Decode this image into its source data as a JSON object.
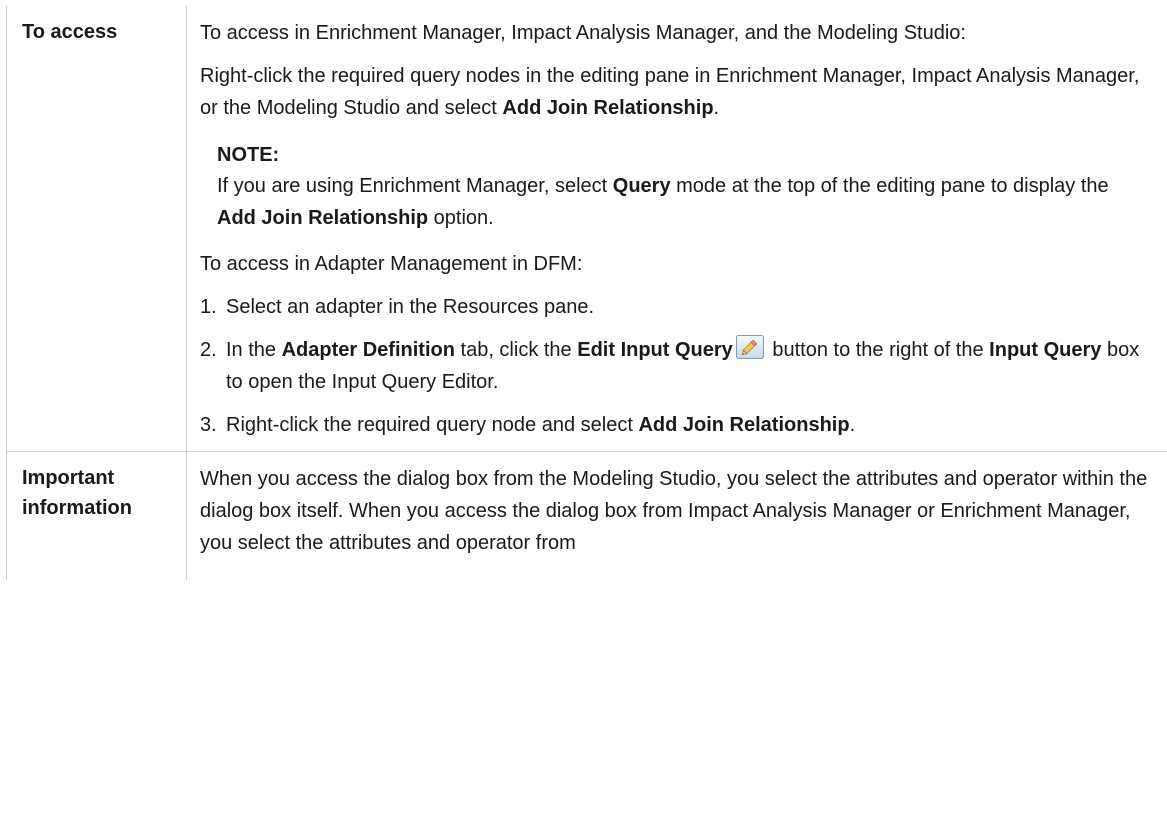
{
  "rows": [
    {
      "label": "To access",
      "intro": "To access in Enrichment Manager, Impact Analysis Manager, and the Modeling Studio:",
      "rightclick": {
        "pre": "Right-click the required query nodes in the editing pane in Enrichment Manager, Impact Analysis Manager, or the Modeling Studio and select ",
        "bold": "Add Join Relationship",
        "post": "."
      },
      "note": {
        "title": "NOTE:",
        "pre": "If you are using Enrichment Manager, select ",
        "bold1": "Query",
        "mid": " mode at the top of the editing pane to display the ",
        "bold2": "Add Join Relationship",
        "post": " option."
      },
      "dfm_intro": "To access in Adapter Management in DFM:",
      "steps": [
        {
          "num": "1.",
          "text": "Select an adapter in the Resources pane."
        },
        {
          "num": "2.",
          "pre": "In the ",
          "bold1": "Adapter Definition",
          "mid1": " tab, click the ",
          "bold2": "Edit Input Query",
          "icon": "pencil-edit-icon",
          "mid2": " button to the right of the ",
          "bold3": "Input Query",
          "post": " box to open the Input Query Editor."
        },
        {
          "num": "3.",
          "pre": "Right-click the required query node and select ",
          "bold": "Add Join Relationship",
          "post": "."
        }
      ]
    },
    {
      "label": "Important information",
      "text": "When you access the dialog box from the Modeling Studio, you select the attributes and operator within the dialog box itself. When you access the dialog box from Impact Analysis Manager or Enrichment Manager, you select the attributes and operator from"
    }
  ]
}
